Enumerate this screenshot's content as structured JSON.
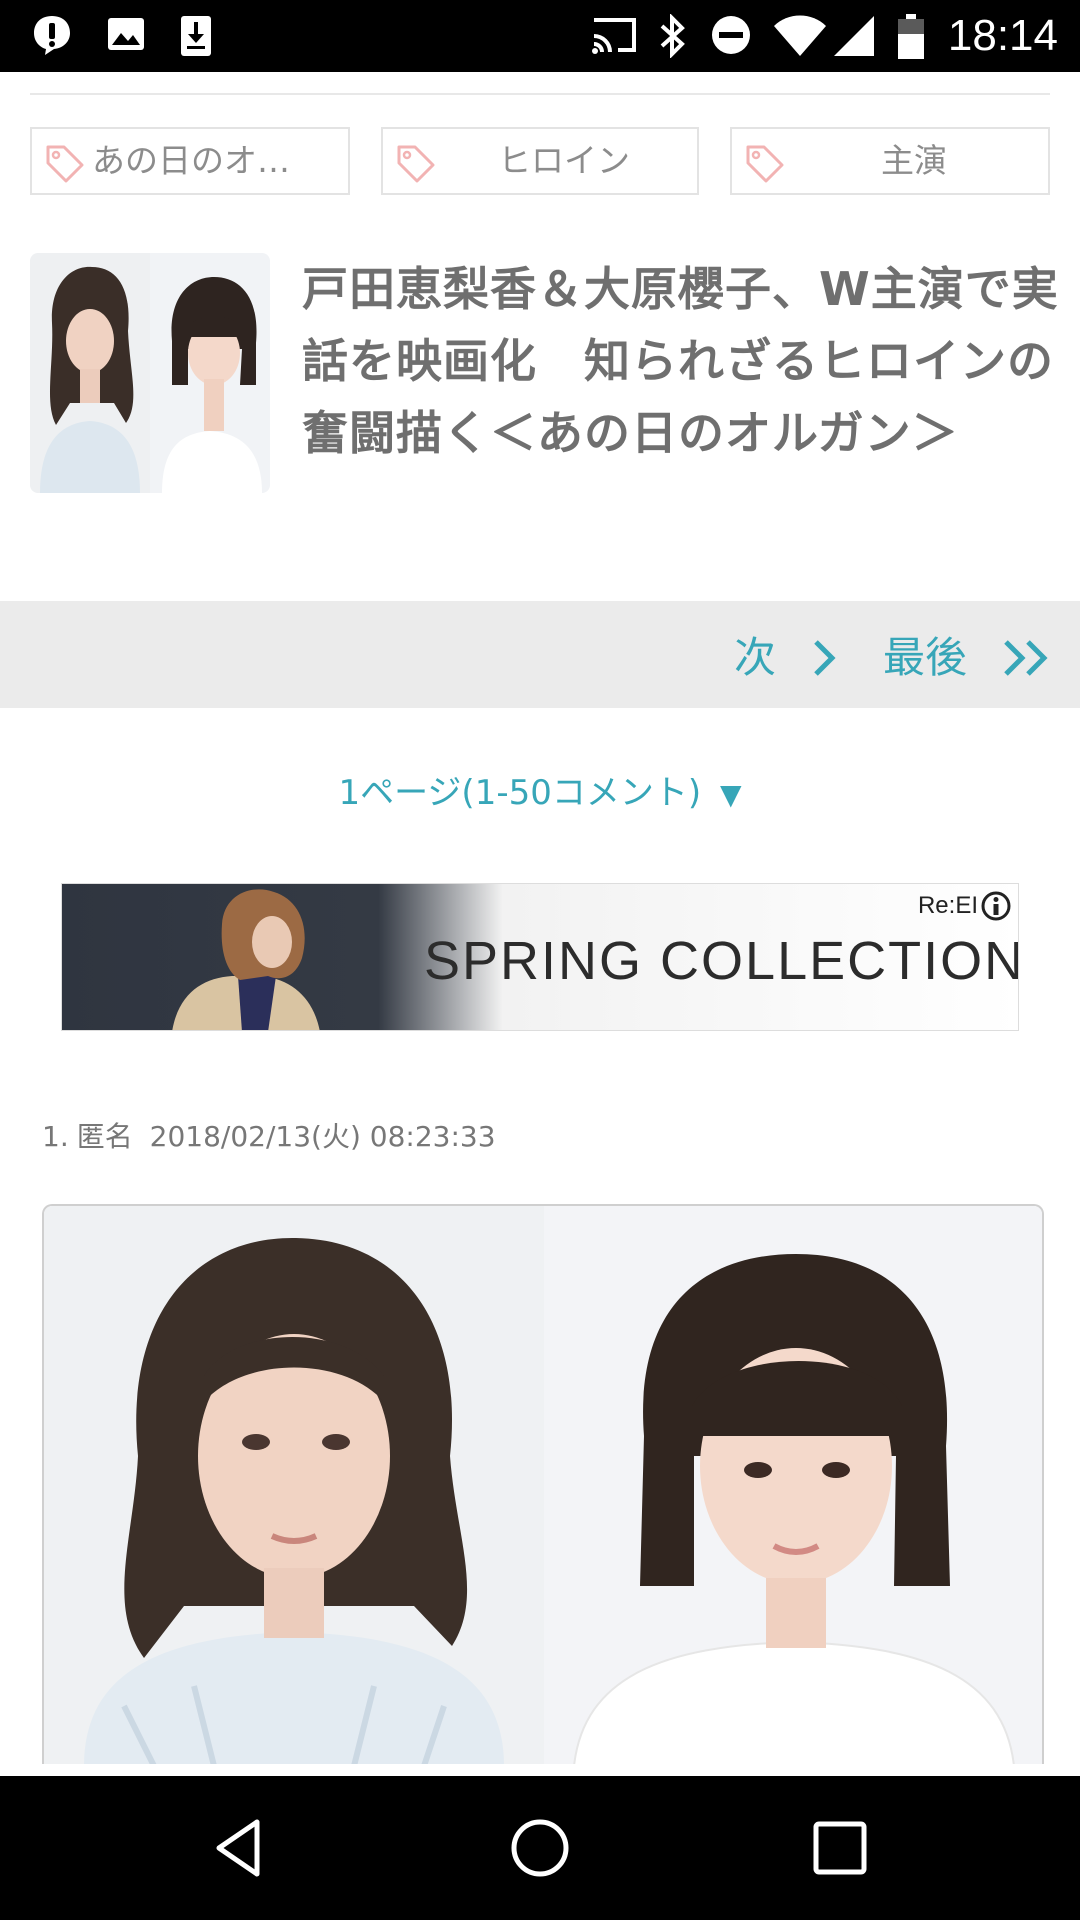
{
  "status_bar": {
    "time": "18:14",
    "left_icons": [
      "alert-icon",
      "image-icon",
      "download-icon"
    ],
    "right_icons": [
      "cast-icon",
      "bluetooth-icon",
      "do-not-disturb-icon",
      "wifi-icon",
      "signal-icon",
      "battery-icon"
    ]
  },
  "tags": [
    {
      "label": "あの日のオ…",
      "icon": "tag-icon"
    },
    {
      "label": "ヒロイン",
      "icon": "tag-icon"
    },
    {
      "label": "主演",
      "icon": "tag-icon"
    }
  ],
  "article": {
    "title": "戸田恵梨香＆大原櫻子、W主演で実話を映画化　知られざるヒロインの奮闘描く＜あの日のオルガン＞"
  },
  "pager": {
    "next_label": "次",
    "last_label": "最後"
  },
  "page_select": {
    "label": "1ページ(1-50コメント)",
    "caret": "▼"
  },
  "ad": {
    "brand": "Re:EI",
    "headline": "SPRING COLLECTION"
  },
  "comment": {
    "number": "1.",
    "author": "匿名",
    "timestamp": "2018/02/13(火) 08:23:33"
  },
  "nav_bar": {
    "buttons": [
      "back-icon",
      "home-icon",
      "recents-icon"
    ]
  },
  "colors": {
    "accent": "#37a6b8",
    "title": "#6f6f6f",
    "pager_bg": "#ebebeb"
  }
}
